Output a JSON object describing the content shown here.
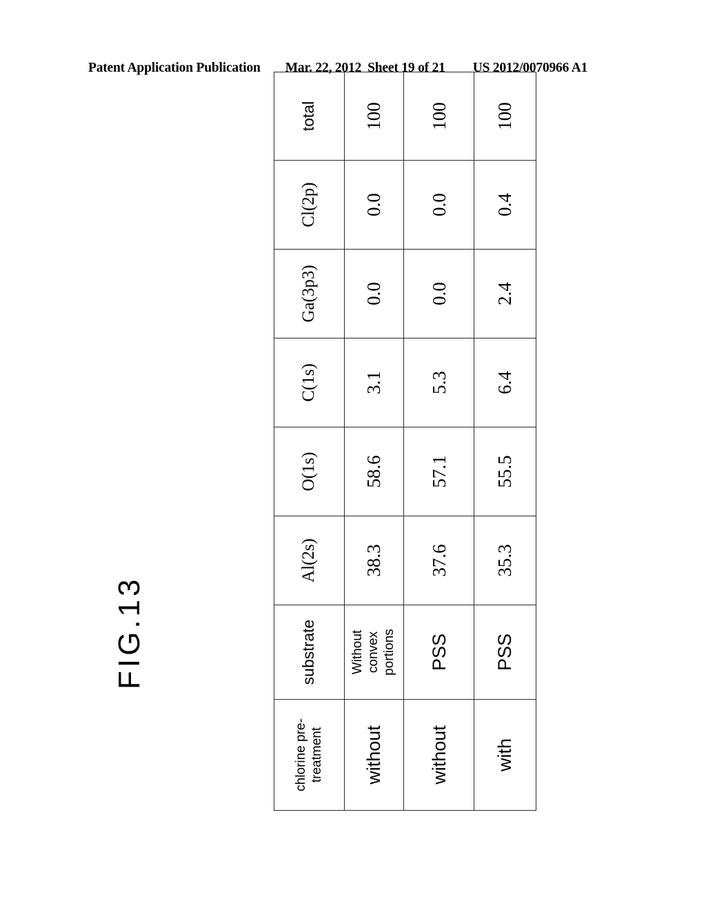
{
  "header": {
    "publication": "Patent Application Publication",
    "date": "Mar. 22, 2012",
    "sheet": "Sheet 19 of 21",
    "number": "US 2012/0070966 A1"
  },
  "figure": {
    "label": "FIG.13"
  },
  "chart_data": {
    "type": "table",
    "title": "FIG.13",
    "columns": [
      "chlorine pre-treatment",
      "substrate",
      "Al(2s)",
      "O(1s)",
      "C(1s)",
      "Ga(3p3)",
      "Cl(2p)",
      "total"
    ],
    "rows": [
      {
        "chlorine_pretreatment": "without",
        "substrate": "Without convex portions",
        "substrate_lines": [
          "Without",
          "convex",
          "portions"
        ],
        "Al2s": "38.3",
        "O1s": "58.6",
        "C1s": "3.1",
        "Ga3p3": "0.0",
        "Cl2p": "0.0",
        "total": "100"
      },
      {
        "chlorine_pretreatment": "without",
        "substrate": "PSS",
        "substrate_lines": [
          "PSS"
        ],
        "Al2s": "37.6",
        "O1s": "57.1",
        "C1s": "5.3",
        "Ga3p3": "0.0",
        "Cl2p": "0.0",
        "total": "100"
      },
      {
        "chlorine_pretreatment": "with",
        "substrate": "PSS",
        "substrate_lines": [
          "PSS"
        ],
        "Al2s": "35.3",
        "O1s": "55.5",
        "C1s": "6.4",
        "Ga3p3": "2.4",
        "Cl2p": "0.4",
        "total": "100"
      }
    ]
  },
  "table": {
    "head": {
      "treatment_line1": "chlorine pre-",
      "treatment_line2": "treatment",
      "substrate": "substrate",
      "al2s": "Al(2s)",
      "o1s": "O(1s)",
      "c1s": "C(1s)",
      "ga3p3": "Ga(3p3)",
      "cl2p": "Cl(2p)",
      "total": "total"
    },
    "rows": [
      {
        "treatment": "without",
        "sub_l1": "Without",
        "sub_l2": "convex",
        "sub_l3": "portions",
        "al2s": "38.3",
        "o1s": "58.6",
        "c1s": "3.1",
        "ga3p3": "0.0",
        "cl2p": "0.0",
        "total": "100"
      },
      {
        "treatment": "without",
        "sub_l1": "PSS",
        "al2s": "37.6",
        "o1s": "57.1",
        "c1s": "5.3",
        "ga3p3": "0.0",
        "cl2p": "0.0",
        "total": "100"
      },
      {
        "treatment": "with",
        "sub_l1": "PSS",
        "al2s": "35.3",
        "o1s": "55.5",
        "c1s": "6.4",
        "ga3p3": "2.4",
        "cl2p": "0.4",
        "total": "100"
      }
    ]
  }
}
